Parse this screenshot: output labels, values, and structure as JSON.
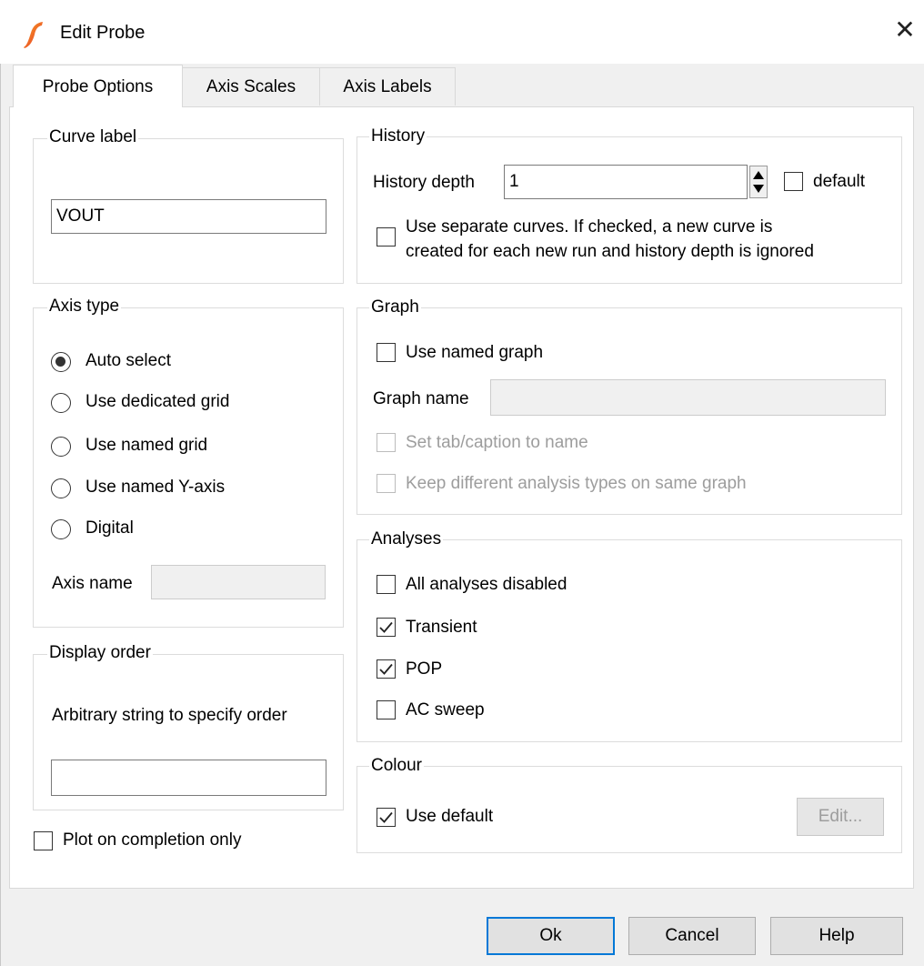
{
  "window": {
    "title": "Edit Probe",
    "close_icon": "close-icon"
  },
  "tabs": [
    {
      "label": "Probe Options",
      "active": true
    },
    {
      "label": "Axis Scales",
      "active": false
    },
    {
      "label": "Axis Labels",
      "active": false
    }
  ],
  "curve_label": {
    "legend": "Curve label",
    "value": "VOUT"
  },
  "axis_type": {
    "legend": "Axis type",
    "options": [
      {
        "label": "Auto select",
        "selected": true
      },
      {
        "label": "Use dedicated grid",
        "selected": false
      },
      {
        "label": "Use named grid",
        "selected": false
      },
      {
        "label": "Use named Y-axis",
        "selected": false
      },
      {
        "label": "Digital",
        "selected": false
      }
    ],
    "axis_name_label": "Axis name",
    "axis_name_value": ""
  },
  "display_order": {
    "legend": "Display order",
    "description": "Arbitrary string to specify order",
    "value": ""
  },
  "plot_on_completion": {
    "label": "Plot on completion only",
    "checked": false
  },
  "history": {
    "legend": "History",
    "depth_label": "History depth",
    "depth_value": "1",
    "default_label": "default",
    "default_checked": false,
    "separate_line1": "Use separate curves. If checked, a new curve is",
    "separate_line2": "created for each new run and history depth is ignored",
    "separate_checked": false
  },
  "graph": {
    "legend": "Graph",
    "use_named_label": "Use named graph",
    "use_named_checked": false,
    "name_label": "Graph name",
    "name_value": "",
    "set_tab_label": "Set tab/caption to name",
    "keep_label": "Keep different analysis types on same graph"
  },
  "analyses": {
    "legend": "Analyses",
    "items": [
      {
        "label": "All analyses disabled",
        "checked": false
      },
      {
        "label": "Transient",
        "checked": true
      },
      {
        "label": "POP",
        "checked": true
      },
      {
        "label": "AC sweep",
        "checked": false
      }
    ]
  },
  "colour": {
    "legend": "Colour",
    "use_default_label": "Use default",
    "use_default_checked": true,
    "edit_label": "Edit..."
  },
  "buttons": {
    "ok": "Ok",
    "cancel": "Cancel",
    "help": "Help"
  },
  "colors": {
    "accent": "#0078d7",
    "icon_red": "#e8302a",
    "icon_orange": "#f6a623"
  }
}
